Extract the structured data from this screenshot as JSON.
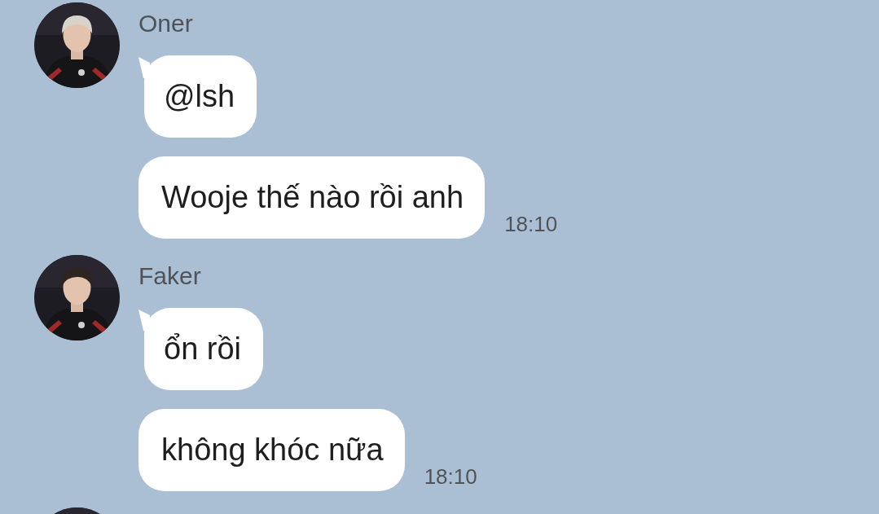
{
  "groups": [
    {
      "sender": "Oner",
      "avatar": {
        "kind": "picture"
      },
      "messages": [
        {
          "text": "@lsh"
        },
        {
          "text": "Wooje thế nào rồi anh",
          "time": "18:10"
        }
      ]
    },
    {
      "sender": "Faker",
      "avatar": {
        "kind": "picture"
      },
      "messages": [
        {
          "text": "ổn rồi"
        },
        {
          "text": "không khóc nữa",
          "time": "18:10"
        }
      ]
    },
    {
      "avatar": {
        "kind": "picture"
      }
    }
  ]
}
